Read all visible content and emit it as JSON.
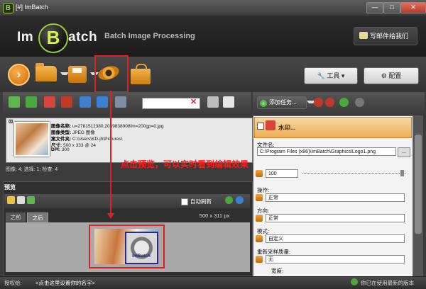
{
  "window": {
    "title": "[#] ImBatch",
    "app_icon_letter": "B",
    "controls": {
      "minimize": "—",
      "maximize": "□",
      "close": "✕"
    }
  },
  "banner": {
    "logo_left": "Im",
    "logo_center": "B",
    "logo_right": "atch",
    "subtitle": "Batch Image Processing",
    "mail_button": "写邮件给我们"
  },
  "toolbar": {
    "tools_button": "工具",
    "settings_button": "配置"
  },
  "file_info": {
    "name_label": "图像名称:",
    "name_value": "u=2781512380,2039838908fm=200gp=0.jpg",
    "type_label": "图像类型:",
    "type_value": "JPEG 图像",
    "folder_label": "案文件夹:",
    "folder_value": "C:\\Users\\KD-jh\\Pictures\\",
    "size_label": "尺寸:",
    "size_value": "500 x 333 @ 24",
    "dpi_label": "DPI:",
    "dpi_value": "300"
  },
  "status_line": "图像: 4; 选择: 1; 检查: 4",
  "annotation": "点击预览，可以实时看到编辑效果",
  "preview": {
    "title": "预览",
    "auto_refresh": "自动刷新",
    "tab_before": "之前",
    "tab_after": "之后",
    "size": "500 x 311 px",
    "watermark_text": "ImBatch"
  },
  "tasks": {
    "add_task": "添加任务...",
    "task_title": "水印...",
    "filename_label": "文件名:",
    "filename_value": "C:\\Program Files (x86)\\ImBatch\\Graphics\\Logo1.png",
    "opacity_value": "100",
    "operation_label": "操作:",
    "operation_value": "正常",
    "direction_label": "方向:",
    "direction_value": "正常",
    "mode_label": "模式:",
    "mode_value": "自定义",
    "resample_label": "重新采样质量:",
    "resample_value": "无",
    "width_label": "宽度:"
  },
  "statusbar": {
    "license_label": "授权给:",
    "license_value": "<点击这里设置你的名字>",
    "latest": "你已在使用最新的版本"
  },
  "colors": {
    "accent_orange": "#f1a636",
    "logo_green": "#9acd32",
    "annotation_red": "#e02020"
  },
  "watermarks": {
    "left": "",
    "right": ""
  }
}
